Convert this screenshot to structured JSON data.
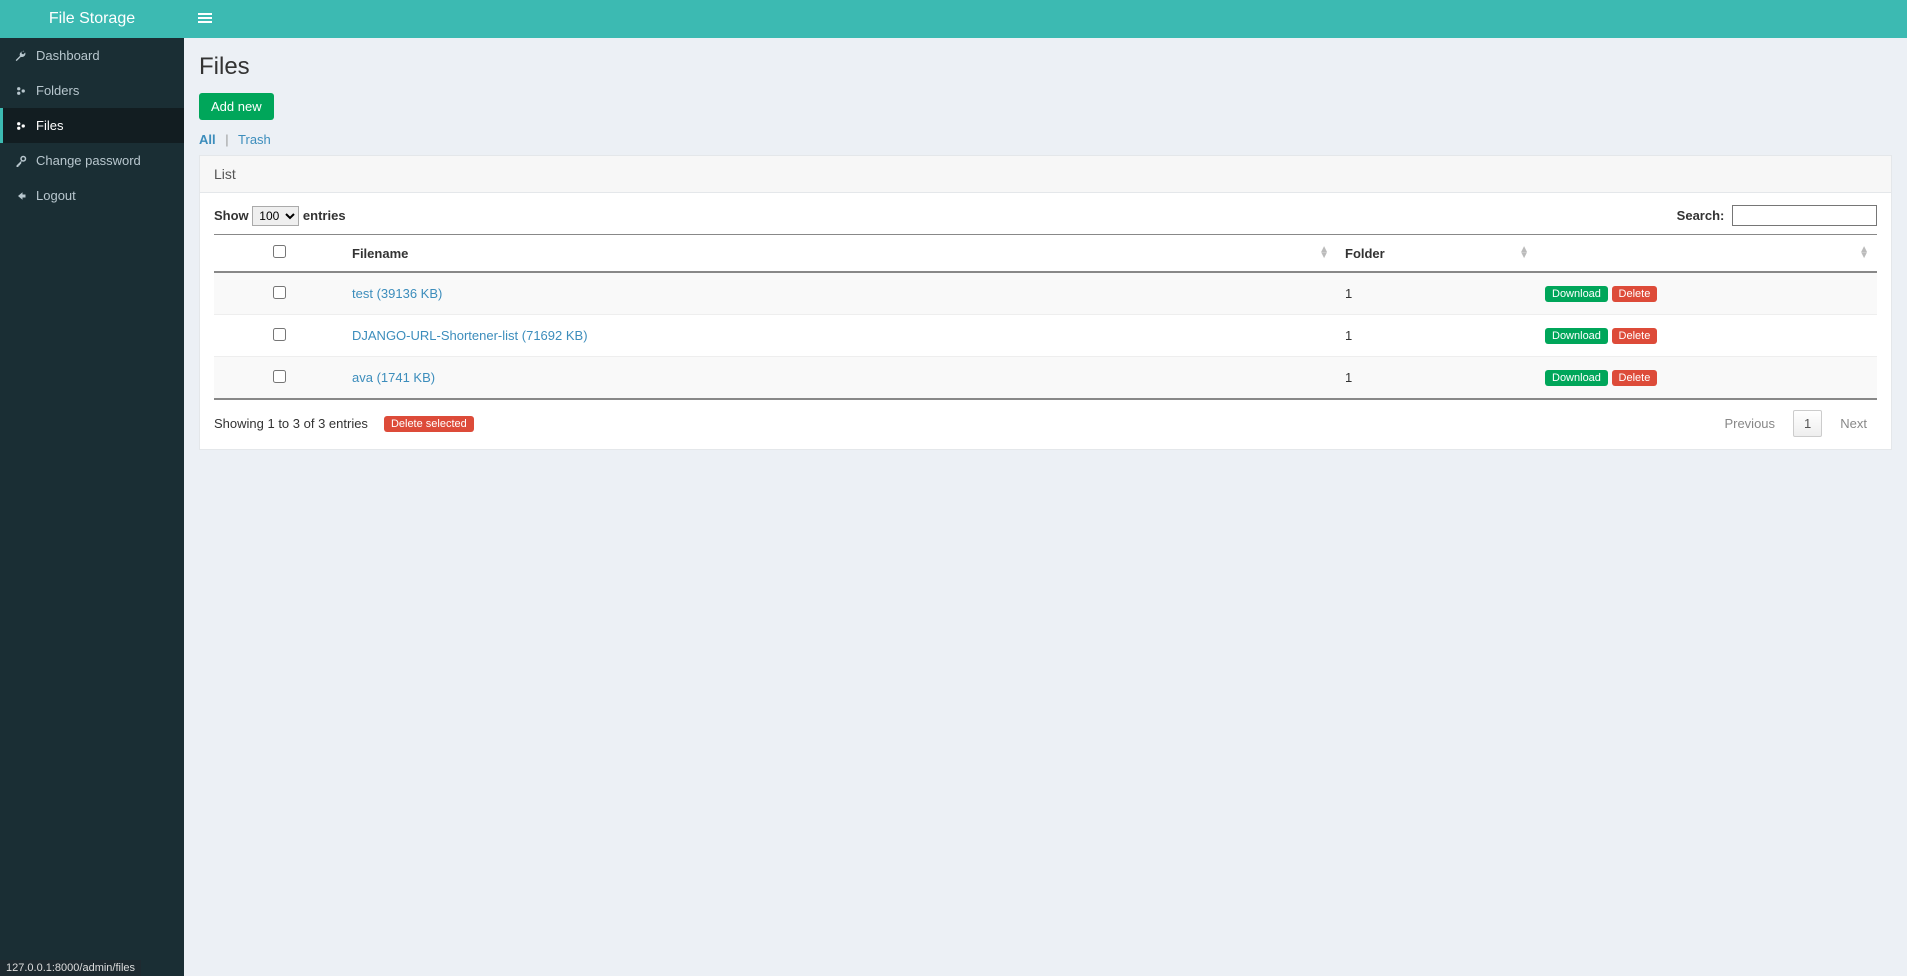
{
  "brand": "File Storage",
  "sidebar": {
    "items": [
      {
        "label": "Dashboard",
        "icon": "wrench",
        "active": false
      },
      {
        "label": "Folders",
        "icon": "cogs",
        "active": false
      },
      {
        "label": "Files",
        "icon": "cogs",
        "active": true
      },
      {
        "label": "Change password",
        "icon": "key",
        "active": false
      },
      {
        "label": "Logout",
        "icon": "arrow-left",
        "active": false
      }
    ]
  },
  "page": {
    "title": "Files",
    "add_new": "Add new",
    "filter_all": "All",
    "filter_trash": "Trash",
    "panel_title": "List"
  },
  "table": {
    "show_label_pre": "Show",
    "show_label_post": "entries",
    "show_value": "100",
    "search_label": "Search:",
    "columns": {
      "checkbox": "",
      "filename": "Filename",
      "folder": "Folder",
      "actions": ""
    },
    "rows": [
      {
        "filename": "test (39136 KB)",
        "folder": "1"
      },
      {
        "filename": "DJANGO-URL-Shortener-list (71692 KB)",
        "folder": "1"
      },
      {
        "filename": "ava (1741 KB)",
        "folder": "1"
      }
    ],
    "actions": {
      "download": "Download",
      "delete": "Delete"
    },
    "info": "Showing 1 to 3 of 3 entries",
    "delete_selected": "Delete selected",
    "pagination": {
      "previous": "Previous",
      "page": "1",
      "next": "Next"
    }
  },
  "status_url": "127.0.0.1:8000/admin/files"
}
